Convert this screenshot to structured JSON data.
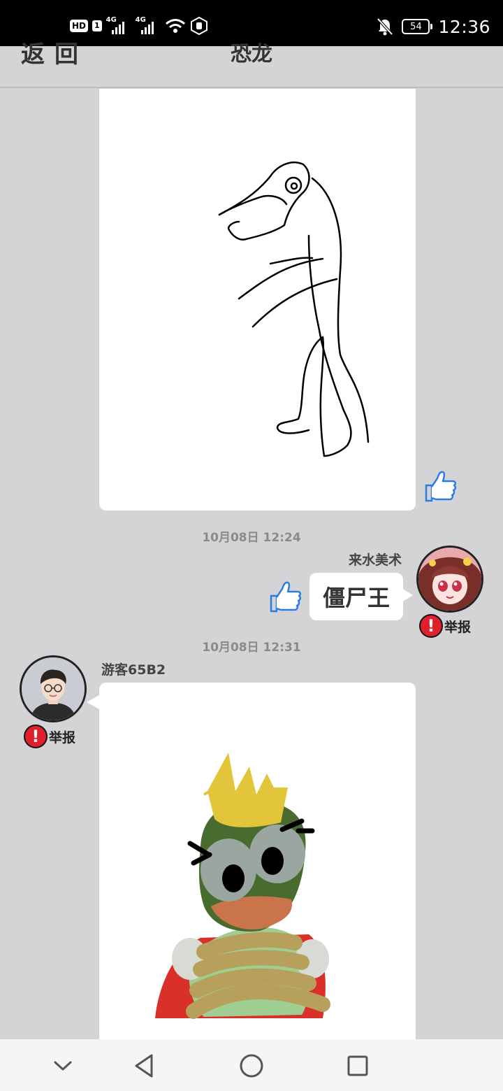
{
  "status_bar": {
    "hd_label": "HD",
    "sim_label": "1",
    "network1": "4G",
    "network2": "4G",
    "battery": "54",
    "time": "12:36"
  },
  "header": {
    "back_label": "返回",
    "title": "恐龙"
  },
  "messages": [
    {
      "type": "drawing",
      "side": "left",
      "description_icon": "dinosaur-line-drawing"
    },
    {
      "timestamp": "10月08日  12:24",
      "username": "来水美术",
      "type": "text",
      "side": "right",
      "text": "僵尸王",
      "report_label": "举报"
    },
    {
      "timestamp": "10月08日  12:31",
      "username": "游客65B2",
      "type": "drawing",
      "side": "left",
      "report_label": "举报"
    }
  ],
  "colors": {
    "like_blue": "#2a7de1",
    "report_red": "#e0202a",
    "background": "#d4d4d6"
  },
  "icons": {
    "like": "thumbs-up-icon",
    "report": "exclamation-icon",
    "nav_down": "chevron-down-icon",
    "nav_back": "triangle-back-icon",
    "nav_home": "circle-home-icon",
    "nav_recent": "square-recent-icon"
  }
}
